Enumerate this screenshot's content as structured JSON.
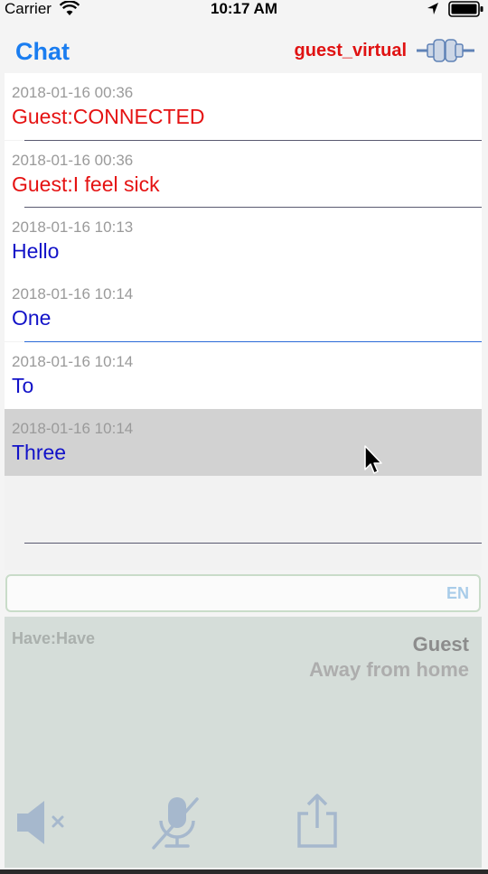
{
  "status_bar": {
    "carrier": "Carrier",
    "time": "10:17 AM"
  },
  "nav": {
    "title": "Chat",
    "user": "guest_virtual"
  },
  "messages": [
    {
      "timestamp": "2018-01-16 00:36",
      "text": "Guest:CONNECTED",
      "color": "#e51212"
    },
    {
      "timestamp": "2018-01-16 00:36",
      "text": "Guest:I feel sick",
      "color": "#e51212"
    },
    {
      "timestamp": "2018-01-16 10:13",
      "text": "Hello",
      "color": "#1212c8"
    },
    {
      "timestamp": "2018-01-16 10:14",
      "text": "One",
      "color": "#1212c8"
    },
    {
      "timestamp": "2018-01-16 10:14",
      "text": "To",
      "color": "#1212c8"
    },
    {
      "timestamp": "2018-01-16 10:14",
      "text": "Three",
      "color": "#1212c8",
      "selected": true
    }
  ],
  "input": {
    "value": "",
    "language": "EN"
  },
  "panel": {
    "status": "Have:Have",
    "peer_name": "Guest",
    "peer_status": "Away from home"
  },
  "toolbar": {
    "icons": [
      "speaker-muted-icon",
      "microphone-off-icon",
      "share-icon"
    ]
  },
  "colors": {
    "accent": "#1a7df0",
    "guest_text": "#e51212",
    "own_text": "#1212c8",
    "selected_row": "#d2d2d2",
    "panel_bg": "#d5ddd9"
  }
}
